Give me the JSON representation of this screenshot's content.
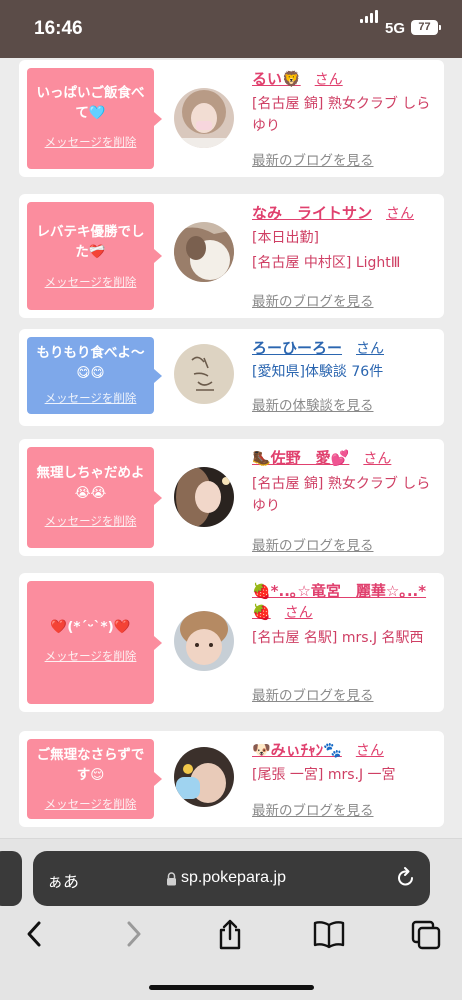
{
  "status": {
    "time": "16:46",
    "network": "5G",
    "battery": "77"
  },
  "cards": [
    {
      "bubble_color": "pink",
      "message": "いっぱいご飯食べて🩵",
      "delete_label": "メッセージを削除",
      "name": "るい🦁",
      "san": "さん",
      "name_color": "#e0406e",
      "details": [
        "[名古屋 錦] 熟女クラブ しらゆり"
      ],
      "link": "最新のブログを見る"
    },
    {
      "bubble_color": "pink",
      "message": "レバテキ優勝でした❤️‍🩹",
      "delete_label": "メッセージを削除",
      "name": "なみ　ライトサン",
      "san": "さん",
      "name_color": "#e0406e",
      "details": [
        "[本日出勤]",
        "[名古屋 中村区] LightⅢ"
      ],
      "link": "最新のブログを見る"
    },
    {
      "bubble_color": "blue",
      "message": "もりもり食べよ〜😋😋",
      "delete_label": "メッセージを削除",
      "name": "ろーひーろー",
      "san": "さん",
      "name_color": "#2b66b0",
      "details": [
        "[愛知県]体験談 76件"
      ],
      "link": "最新の体験談を見る"
    },
    {
      "bubble_color": "pink",
      "message": "無理しちゃだめよ😭😭",
      "delete_label": "メッセージを削除",
      "name": "🥾佐野　愛💕",
      "san": "さん",
      "name_color": "#e0406e",
      "details": [
        "[名古屋 錦] 熟女クラブ しらゆり"
      ],
      "link": "最新のブログを見る"
    },
    {
      "bubble_color": "pink",
      "message": "❤️(*´ᵕ`*)❤️",
      "delete_label": "メッセージを削除",
      "name": "🍓*..｡☆竜宮　麗華☆｡..*🍓",
      "san": "さん",
      "name_color": "#e0406e",
      "details": [
        "[名古屋 名駅] mrs.J 名駅西"
      ],
      "link": "最新のブログを見る"
    },
    {
      "bubble_color": "pink",
      "message": "ご無理なさらずです😌",
      "delete_label": "メッセージを削除",
      "name": "🐶みぃﾁｬﾝ🐾",
      "san": "さん",
      "name_color": "#e0406e",
      "details": [
        "[尾張 一宮] mrs.J 一宮"
      ],
      "link": "最新のブログを見る"
    }
  ],
  "browser": {
    "aa_label": "ぁあ",
    "url": "sp.pokepara.jp",
    "icons": [
      "back-icon",
      "forward-icon",
      "share-icon",
      "bookmarks-icon",
      "tabs-icon"
    ]
  },
  "colors": {
    "accent_pink": "#fb8d9e",
    "accent_blue": "#7ea8ea",
    "name_pink": "#e0406e",
    "detail_pink": "#cf3f64",
    "name_blue": "#2b66b0"
  }
}
